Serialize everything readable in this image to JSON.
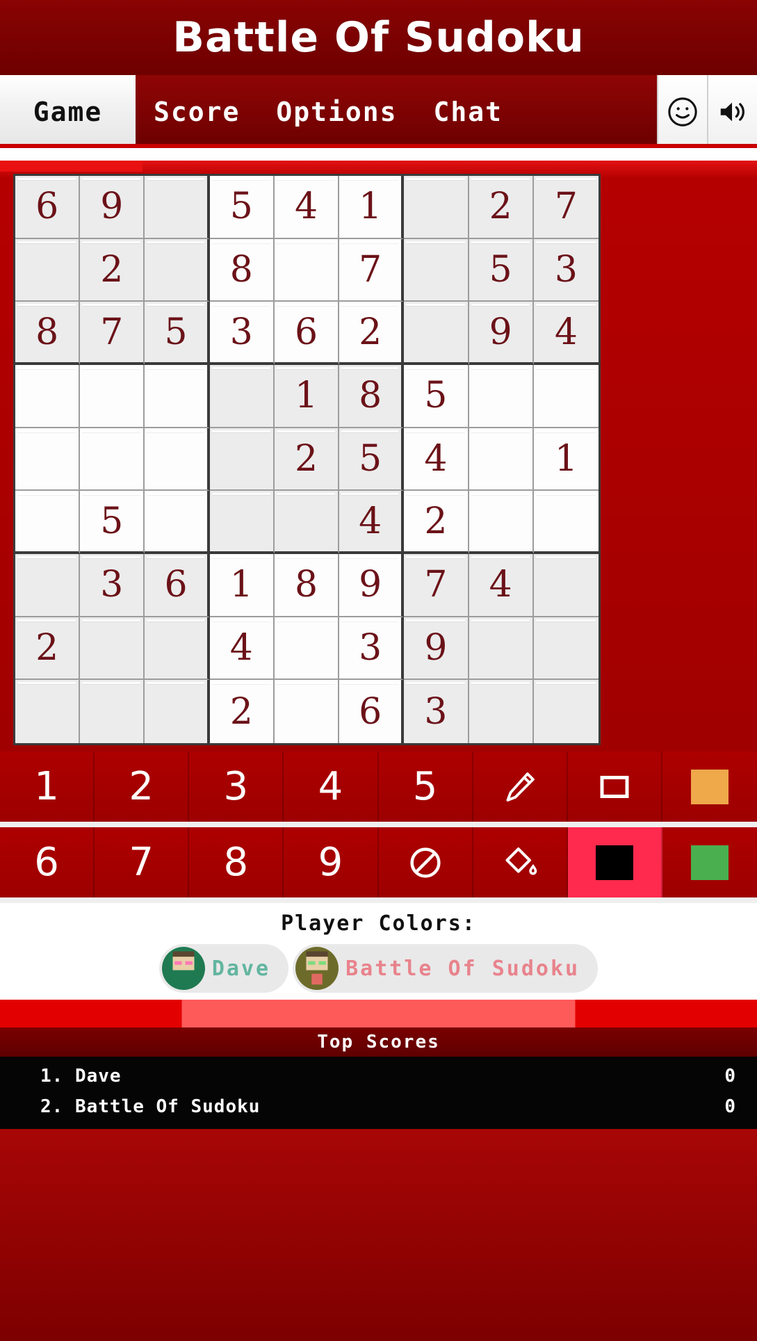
{
  "header": {
    "title": "Battle Of Sudoku"
  },
  "tabs": {
    "items": [
      {
        "label": "Game",
        "active": true
      },
      {
        "label": "Score",
        "active": false
      },
      {
        "label": "Options",
        "active": false
      },
      {
        "label": "Chat",
        "active": false
      }
    ],
    "smiley_icon": "smiley-face-icon",
    "sound_icon": "speaker-volume-icon"
  },
  "board": {
    "grid": [
      [
        "6",
        "9",
        "",
        "5",
        "4",
        "1",
        "",
        "2",
        "7"
      ],
      [
        "",
        "2",
        "",
        "8",
        "",
        "7",
        "",
        "5",
        "3"
      ],
      [
        "8",
        "7",
        "5",
        "3",
        "6",
        "2",
        "",
        "9",
        "4"
      ],
      [
        "",
        "",
        "",
        "",
        "1",
        "8",
        "5",
        "",
        ""
      ],
      [
        "",
        "",
        "",
        "",
        "2",
        "5",
        "4",
        "",
        "1"
      ],
      [
        "",
        "5",
        "",
        "",
        "",
        "4",
        "2",
        "",
        ""
      ],
      [
        "",
        "3",
        "6",
        "1",
        "8",
        "9",
        "7",
        "4",
        ""
      ],
      [
        "2",
        "",
        "",
        "4",
        "",
        "3",
        "9",
        "",
        ""
      ],
      [
        "",
        "",
        "",
        "2",
        "",
        "6",
        "3",
        "",
        ""
      ]
    ]
  },
  "pads": {
    "row1": [
      {
        "label": "1",
        "kind": "number"
      },
      {
        "label": "2",
        "kind": "number"
      },
      {
        "label": "3",
        "kind": "number"
      },
      {
        "label": "4",
        "kind": "number"
      },
      {
        "label": "5",
        "kind": "number"
      },
      {
        "label": "",
        "kind": "icon",
        "icon": "pencil-icon"
      },
      {
        "label": "",
        "kind": "icon",
        "icon": "square-outline-icon"
      },
      {
        "label": "",
        "kind": "swatch",
        "icon": "orange-color-swatch",
        "color": "#efa84a"
      }
    ],
    "row2": [
      {
        "label": "6",
        "kind": "number"
      },
      {
        "label": "7",
        "kind": "number"
      },
      {
        "label": "8",
        "kind": "number"
      },
      {
        "label": "9",
        "kind": "number"
      },
      {
        "label": "",
        "kind": "icon",
        "icon": "erase-no-entry-icon"
      },
      {
        "label": "",
        "kind": "icon",
        "icon": "paint-bucket-icon"
      },
      {
        "label": "",
        "kind": "swatch",
        "icon": "black-color-swatch",
        "color": "#000000",
        "selected": true
      },
      {
        "label": "",
        "kind": "swatch",
        "icon": "green-color-swatch",
        "color": "#4aaf4f"
      }
    ]
  },
  "player_colors": {
    "label": "Player Colors:",
    "players": [
      {
        "name": "Dave",
        "color": "#63b5a0",
        "avatar_bg": "#1f7a52"
      },
      {
        "name": "Battle Of Sudoku",
        "color": "#e8838c",
        "avatar_bg": "#6d6b2a"
      }
    ]
  },
  "top_scores": {
    "title": "Top Scores",
    "rows": [
      {
        "rank_name": "1. Dave",
        "score": "0"
      },
      {
        "rank_name": "2. Battle Of Sudoku",
        "score": "0"
      }
    ]
  },
  "colors": {
    "brand_red": "#7d0000",
    "board_red": "#b50000",
    "digit": "#6b1218",
    "cell_shaded": "#ececec",
    "cell_light": "#fdfdfd"
  }
}
